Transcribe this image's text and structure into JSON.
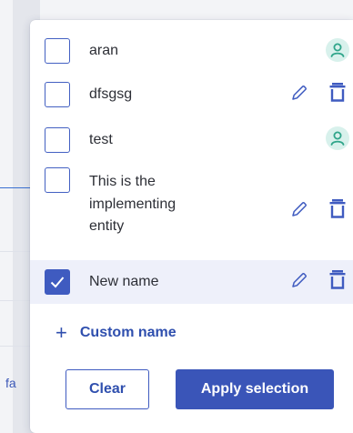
{
  "background": {
    "partial_text": "fa"
  },
  "options": [
    {
      "label": "aran",
      "checked": false,
      "type": "user"
    },
    {
      "label": "dfsgsg",
      "checked": false,
      "type": "custom"
    },
    {
      "label": "test",
      "checked": false,
      "type": "user"
    },
    {
      "label_lines": [
        "This is the",
        "implementing",
        "entity"
      ],
      "checked": false,
      "type": "custom"
    },
    {
      "label": "New name",
      "checked": true,
      "type": "custom"
    }
  ],
  "custom_name": {
    "plus": "+",
    "label": "Custom name"
  },
  "actions": {
    "clear": "Clear",
    "apply": "Apply selection"
  },
  "colors": {
    "accent": "#3a55b8",
    "user_icon": "#2fa58a",
    "checkbox_border": "#4360c2"
  }
}
